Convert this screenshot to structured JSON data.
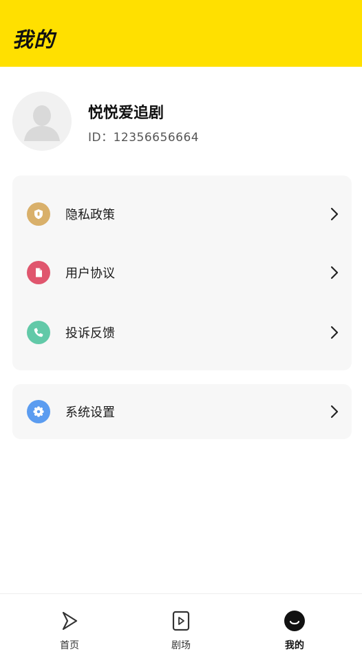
{
  "header": {
    "title": "我的"
  },
  "profile": {
    "name": "悦悦爱追剧",
    "id_text": "ID：12356656664"
  },
  "menu_group_1": [
    {
      "label": "隐私政策",
      "icon": "shield-icon",
      "color": "#D9B06A"
    },
    {
      "label": "用户协议",
      "icon": "document-icon",
      "color": "#E0566E"
    },
    {
      "label": "投诉反馈",
      "icon": "phone-icon",
      "color": "#62C9A8"
    }
  ],
  "menu_group_2": [
    {
      "label": "系统设置",
      "icon": "gear-icon",
      "color": "#5B9CF0"
    }
  ],
  "bottom_nav": [
    {
      "label": "首页",
      "icon": "play-arrow-icon",
      "active": false
    },
    {
      "label": "剧场",
      "icon": "video-card-icon",
      "active": false
    },
    {
      "label": "我的",
      "icon": "smile-icon",
      "active": true
    }
  ],
  "colors": {
    "header_bg": "#FFE000",
    "card_bg": "#F7F7F7"
  }
}
